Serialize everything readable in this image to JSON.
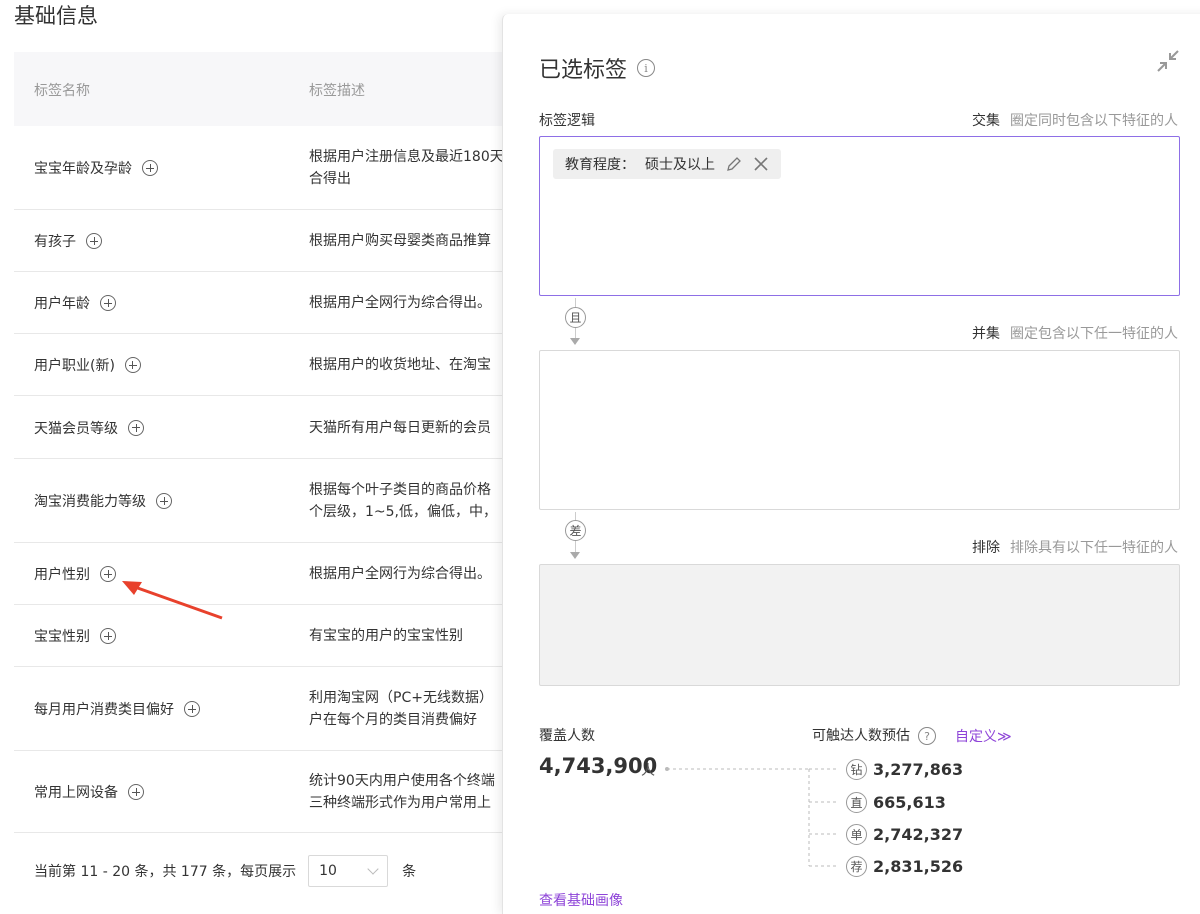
{
  "page_title": "基础信息",
  "table": {
    "headers": [
      "标签名称",
      "标签描述"
    ],
    "rows": [
      {
        "name": "宝宝年龄及孕龄",
        "desc": [
          "根据用户注册信息及最近180天",
          "合得出"
        ]
      },
      {
        "name": "有孩子",
        "desc": [
          "根据用户购买母婴类商品推算"
        ]
      },
      {
        "name": "用户年龄",
        "desc": [
          "根据用户全网行为综合得出。"
        ]
      },
      {
        "name": "用户职业(新)",
        "desc": [
          "根据用户的收货地址、在淘宝"
        ]
      },
      {
        "name": "天猫会员等级",
        "desc": [
          "天猫所有用户每日更新的会员"
        ]
      },
      {
        "name": "淘宝消费能力等级",
        "desc": [
          "根据每个叶子类目的商品价格",
          "个层级，1~5,低，偏低，中，"
        ]
      },
      {
        "name": "用户性别",
        "desc": [
          "根据用户全网行为综合得出。"
        ]
      },
      {
        "name": "宝宝性别",
        "desc": [
          "有宝宝的用户的宝宝性别"
        ]
      },
      {
        "name": "每月用户消费类目偏好",
        "desc": [
          "利用淘宝网（PC+无线数据）",
          "户在每个月的类目消费偏好"
        ]
      },
      {
        "name": "常用上网设备",
        "desc": [
          "统计90天内用户使用各个终端",
          "三种终端形式作为用户常用上"
        ]
      }
    ]
  },
  "pager": {
    "summary": "当前第 11 - 20 条，共 177 条，每页展示",
    "page_size": "10",
    "unit": "条"
  },
  "panel": {
    "title": "已选标签",
    "section_label": "标签逻辑",
    "intersection": {
      "label": "交集",
      "hint": "圈定同时包含以下特征的人"
    },
    "union": {
      "label": "并集",
      "hint": "圈定包含以下任一特征的人"
    },
    "exclude": {
      "label": "排除",
      "hint": "排除具有以下任一特征的人"
    },
    "chip": {
      "key": "教育程度：",
      "value": "硕士及以上"
    },
    "connector_and": "且",
    "connector_diff": "差",
    "coverage_label": "覆盖人数",
    "coverage_value": "4,743,900",
    "coverage_unit": "人",
    "reach_label": "可触达人数预估",
    "custom_link": "自定义≫",
    "reach": [
      {
        "badge": "钻",
        "value": "3,277,863"
      },
      {
        "badge": "直",
        "value": "665,613"
      },
      {
        "badge": "单",
        "value": "2,742,327"
      },
      {
        "badge": "荐",
        "value": "2,831,526"
      }
    ],
    "bottom_link": "查看基础画像"
  },
  "colors": {
    "accent": "#8e6fe6",
    "link": "#8e44d8",
    "arrow": "#e8412c"
  }
}
